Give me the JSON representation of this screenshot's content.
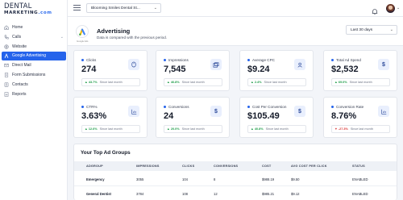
{
  "brand": {
    "line1": "DENTAL",
    "line2": "MARKETING",
    "line2_suffix": ".com"
  },
  "topbar": {
    "account_name": "Blooming Smiles Dental St..."
  },
  "sidebar": {
    "items": [
      {
        "label": "Home",
        "icon": "home-icon"
      },
      {
        "label": "Calls",
        "icon": "phone-icon",
        "has_submenu": true
      },
      {
        "label": "Website",
        "icon": "globe-icon"
      },
      {
        "label": "Google Advertising",
        "icon": "google-ads-icon",
        "active": true
      },
      {
        "label": "Direct Mail",
        "icon": "mail-icon"
      },
      {
        "label": "Form Submissions",
        "icon": "form-icon"
      },
      {
        "label": "Contacts",
        "icon": "contacts-icon"
      },
      {
        "label": "Reports",
        "icon": "reports-icon"
      }
    ]
  },
  "header": {
    "title": "Advertising",
    "subtitle": "Data is compared with the previous period.",
    "logo_caption": "Google Ads",
    "date_range": "Last 30 days"
  },
  "metrics": [
    {
      "label": "Clicks",
      "value": "274",
      "change": "43.7%",
      "direction": "up",
      "since": "Since last month",
      "icon": "cursor-icon"
    },
    {
      "label": "Impressions",
      "value": "7,545",
      "change": "46.8%",
      "direction": "up",
      "since": "Since last month",
      "icon": "window-icon"
    },
    {
      "label": "Average CPC",
      "value": "$9.24",
      "change": "2.4%",
      "direction": "up",
      "since": "Since last month",
      "icon": "user-icon"
    },
    {
      "label": "Total Ad Spend",
      "value": "$2,532",
      "change": "69.0%",
      "direction": "up",
      "since": "Since last month",
      "icon": "dollar-icon"
    },
    {
      "label": "CTR%",
      "value": "3.63%",
      "change": "12.6%",
      "direction": "up",
      "since": "Since last month",
      "icon": "chart-icon"
    },
    {
      "label": "Conversions",
      "value": "24",
      "change": "20.0%",
      "direction": "up",
      "since": "Since last month",
      "icon": "dollar-icon"
    },
    {
      "label": "Cost Per Conversion",
      "value": "$105.49",
      "change": "40.8%",
      "direction": "up",
      "since": "Since last month",
      "icon": "dollar-icon"
    },
    {
      "label": "Conversion Rate",
      "value": "8.76%",
      "change": "-27.3%",
      "direction": "down",
      "since": "Since last month",
      "icon": "chart-icon"
    }
  ],
  "ad_groups": {
    "title": "Your Top Ad Groups",
    "columns": [
      "ADGROUP",
      "IMPRESSIONS",
      "CLICKS",
      "CONVERSIONS",
      "COST",
      "AVG COST PER CLICK",
      "STATUS"
    ],
    "rows": [
      [
        "Emergency",
        "3055",
        "104",
        "8",
        "$988.19",
        "$9.50",
        "ENABLED"
      ],
      [
        "General Dentist",
        "3784",
        "108",
        "12",
        "$985.21",
        "$9.12",
        "ENABLED"
      ]
    ]
  },
  "colors": {
    "accent": "#2563eb",
    "positive": "#1f9d4a",
    "negative": "#d93636"
  }
}
